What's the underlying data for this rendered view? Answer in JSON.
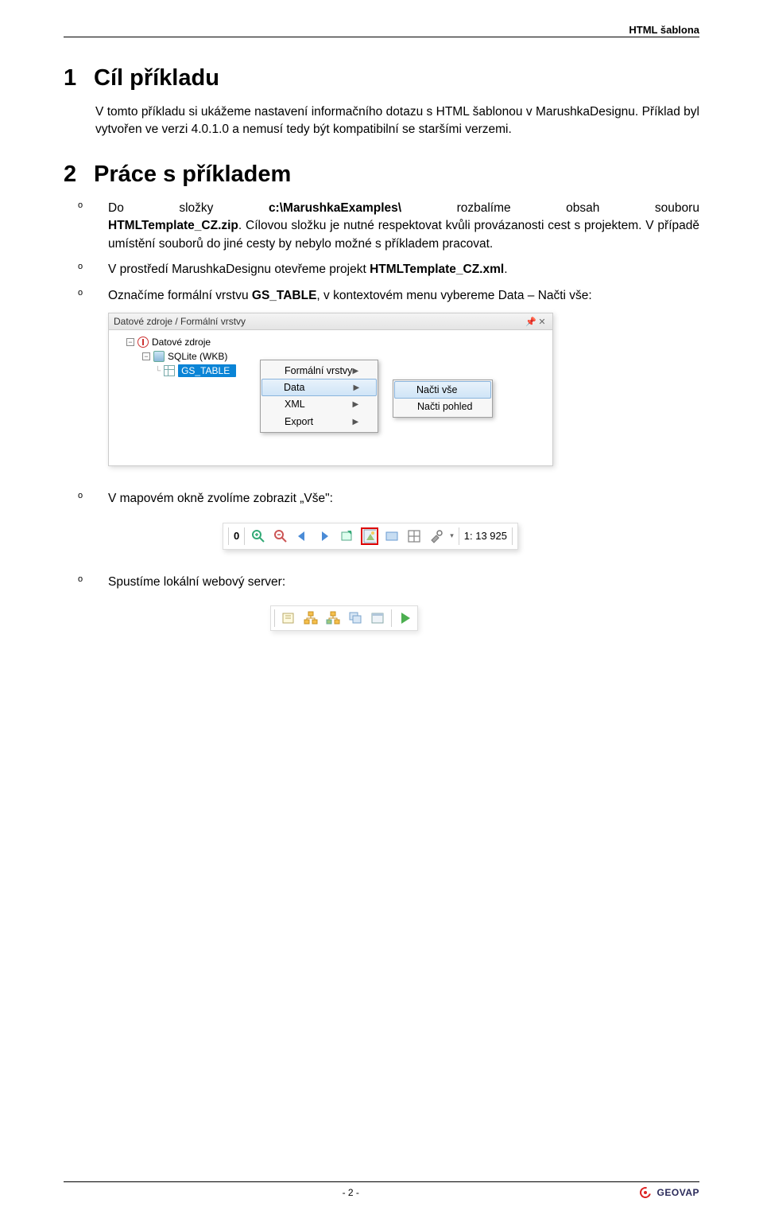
{
  "header": {
    "right": "HTML šablona"
  },
  "section1": {
    "num": "1",
    "title": "Cíl příkladu",
    "para": "V tomto příkladu si ukážeme nastavení informačního dotazu s HTML šablonou v MarushkaDesignu. Příklad byl vytvořen ve verzi 4.0.1.0 a nemusí tedy být kompatibilní se staršími verzemi."
  },
  "section2": {
    "num": "2",
    "title": "Práce s příkladem",
    "items": [
      {
        "line_words": [
          "Do",
          "složky",
          "c:\\MarushkaExamples\\",
          "rozbalíme",
          "obsah",
          "souboru"
        ],
        "bold_word_idx": 2,
        "rest": "HTMLTemplate_CZ.zip",
        "rest_tail": ". Cílovou složku je nutné respektovat kvůli provázanosti cest s projektem. V případě umístění souborů do jiné cesty by nebylo možné s příkladem pracovat."
      },
      {
        "text_pre": "V prostředí MarushkaDesignu otevřeme projekt ",
        "bold": "HTMLTemplate_CZ.xml",
        "text_post": "."
      },
      {
        "text_pre": "Označíme formální vrstvu ",
        "bold": "GS_TABLE",
        "text_post": ", v kontextovém menu vybereme Data – Načti vše:"
      }
    ]
  },
  "panel": {
    "title": "Datové zdroje / Formální vrstvy",
    "root": "Datové zdroje",
    "node1": "SQLite (WKB)",
    "leaf": "GS_TABLE",
    "menu": [
      "Formální vrstvy",
      "Data",
      "XML",
      "Export"
    ],
    "menu_hl_idx": 1,
    "submenu": [
      "Načti vše",
      "Načti pohled"
    ],
    "submenu_hl_idx": 0
  },
  "step_map": {
    "text": "V mapovém okně zvolíme zobrazit „Vše\":"
  },
  "toolbar1": {
    "counter": "0",
    "scale": "1: 13 925"
  },
  "step_server": {
    "text": "Spustíme lokální webový server:"
  },
  "footer": {
    "page": "- 2 -",
    "brand": "GEOVAP"
  }
}
